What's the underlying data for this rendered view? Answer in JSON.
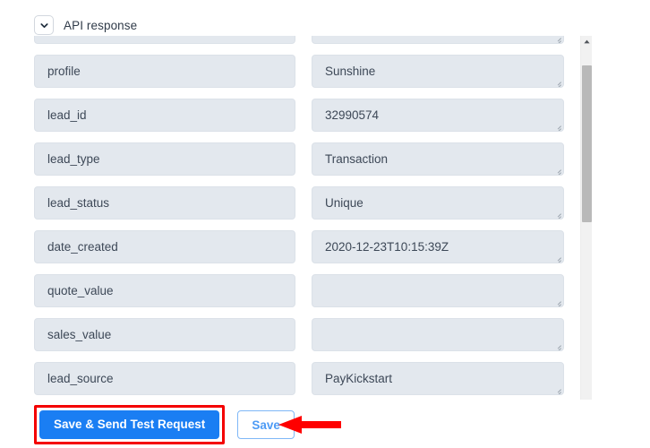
{
  "section": {
    "title": "API response",
    "collapse_icon": "chevron-down-icon",
    "expanded": true
  },
  "fields": [
    {
      "key": "",
      "value": "",
      "partial": true
    },
    {
      "key": "profile",
      "value": "Sunshine"
    },
    {
      "key": "lead_id",
      "value": "32990574"
    },
    {
      "key": "lead_type",
      "value": "Transaction"
    },
    {
      "key": "lead_status",
      "value": "Unique"
    },
    {
      "key": "date_created",
      "value": "2020-12-23T10:15:39Z"
    },
    {
      "key": "quote_value",
      "value": ""
    },
    {
      "key": "sales_value",
      "value": ""
    },
    {
      "key": "lead_source",
      "value": "PayKickstart"
    }
  ],
  "scrollbar": {
    "up_arrow_icon": "scroll-up-arrow-icon",
    "thumb_color": "#b9b9b9",
    "track_color": "#f1f1f1"
  },
  "footer": {
    "primary_label": "Save & Send Test Request",
    "secondary_label": "Save"
  },
  "annotations": {
    "highlight_color": "#f40000",
    "arrow_icon": "left-arrow-icon",
    "arrow_color": "#ff0000"
  },
  "colors": {
    "primary_button": "#1a7ef3",
    "secondary_button_text": "#4d9bf5",
    "field_background": "#e3e8ee",
    "field_text": "#3d4857"
  }
}
